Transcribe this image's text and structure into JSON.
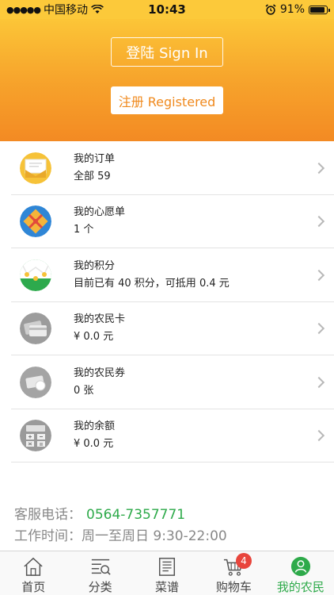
{
  "status_bar": {
    "carrier": "中国移动",
    "time": "10:43",
    "battery": "91%",
    "battery_level": 0.91
  },
  "header": {
    "signin_label": "登陆 Sign In",
    "register_label": "注册 Registered",
    "gradient_top": "#fdd03b",
    "gradient_bottom": "#f38a23"
  },
  "menu": [
    {
      "title": "我的订单",
      "sub": "全部 59",
      "icon": "envelope-icon"
    },
    {
      "title": "我的心愿单",
      "sub": "1 个",
      "icon": "gift-icon"
    },
    {
      "title": "我的积分",
      "sub": "目前已有 40 积分，可抵用 0.4 元",
      "icon": "points-icon"
    },
    {
      "title": "我的农民卡",
      "sub": "¥  0.0 元",
      "icon": "card-icon"
    },
    {
      "title": "我的农民券",
      "sub": "0 张",
      "icon": "coupon-icon"
    },
    {
      "title": "我的余额",
      "sub": "¥  0.0 元",
      "icon": "calculator-icon"
    }
  ],
  "contact": {
    "phone_label": "客服电话：",
    "phone": "0564-7357771",
    "hours_label": "工作时间：",
    "hours": "周一至周日 9:30-22:00"
  },
  "tabbar": {
    "tabs": [
      {
        "label": "首页",
        "icon": "home-icon"
      },
      {
        "label": "分类",
        "icon": "category-icon"
      },
      {
        "label": "菜谱",
        "icon": "recipe-icon"
      },
      {
        "label": "购物车",
        "icon": "cart-icon",
        "badge": "4"
      },
      {
        "label": "我的农民",
        "icon": "user-icon",
        "active": true
      }
    ],
    "active_color": "#2eaa4a"
  }
}
